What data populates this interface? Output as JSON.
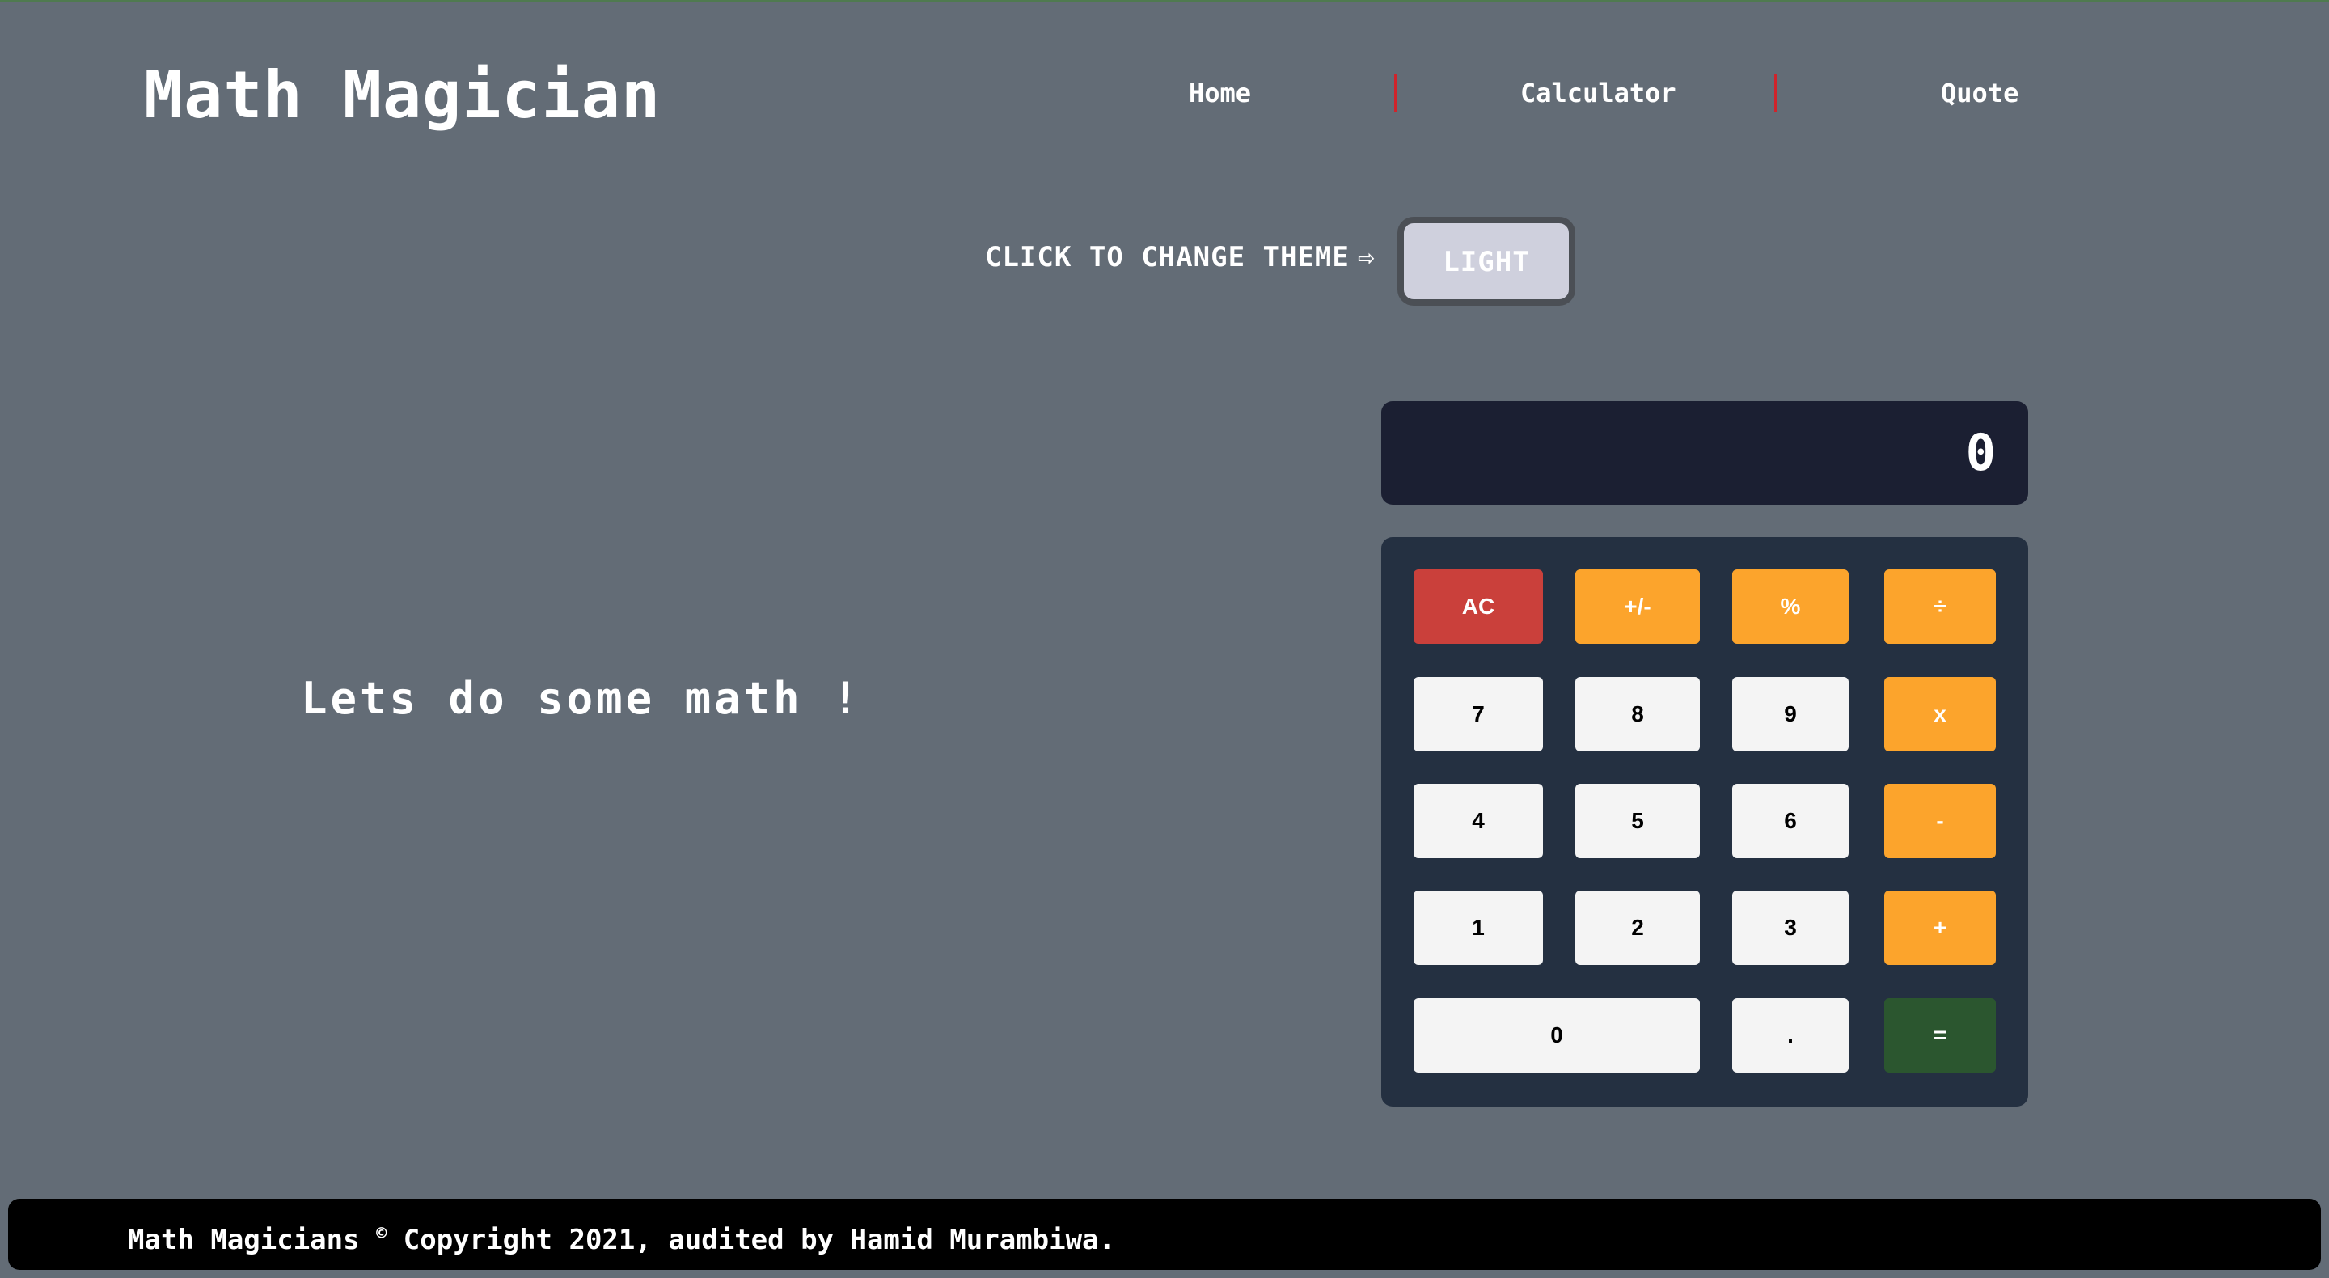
{
  "header": {
    "brand": "Math Magician",
    "nav": [
      {
        "label": "Home"
      },
      {
        "label": "Calculator"
      },
      {
        "label": "Quote"
      }
    ]
  },
  "theme": {
    "label": "CLICK TO CHANGE THEME",
    "arrow": "⇨",
    "button_label": "LIGHT"
  },
  "hero": {
    "text": "Lets do some math !"
  },
  "calculator": {
    "display": "0",
    "keys": {
      "ac": "AC",
      "sign": "+/-",
      "percent": "%",
      "divide": "÷",
      "seven": "7",
      "eight": "8",
      "nine": "9",
      "multiply": "x",
      "four": "4",
      "five": "5",
      "six": "6",
      "subtract": "-",
      "one": "1",
      "two": "2",
      "three": "3",
      "add": "+",
      "zero": "0",
      "decimal": ".",
      "equals": "="
    }
  },
  "footer": {
    "prefix": "Math Magicians",
    "copyright_symbol": "©",
    "suffix": "Copyright 2021, audited by Hamid Murambiwa."
  },
  "colors": {
    "page_background": "#636c76",
    "display_background": "#1b1f32",
    "keypad_background": "#243041",
    "operator_key": "#fca42c",
    "clear_key": "#ca403b",
    "equals_key": "#2b562f",
    "number_key": "#f4f4f4",
    "nav_separator": "#d0232a",
    "footer_background": "#000000"
  }
}
